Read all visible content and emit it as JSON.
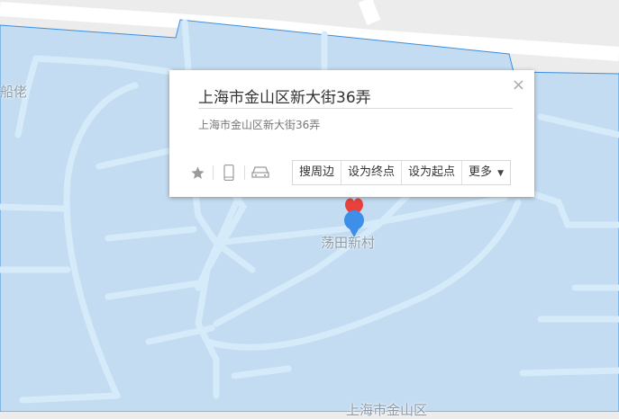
{
  "map": {
    "labels": {
      "top_left": "船佬",
      "village": "荡田新村",
      "district": "上海市金山区"
    }
  },
  "popup": {
    "title": "上海市金山区新大街36弄",
    "address": "上海市金山区新大街36弄",
    "close_symbol": "×",
    "actions": {
      "nearby": "搜周边",
      "set_destination": "设为终点",
      "set_origin": "设为起点",
      "more": "更多"
    }
  },
  "colors": {
    "area_fill": "#c4dcf1",
    "road": "#d6ebfa",
    "background": "#ececec",
    "marker_blue": "#3d8fea",
    "marker_red": "#e8403b"
  }
}
